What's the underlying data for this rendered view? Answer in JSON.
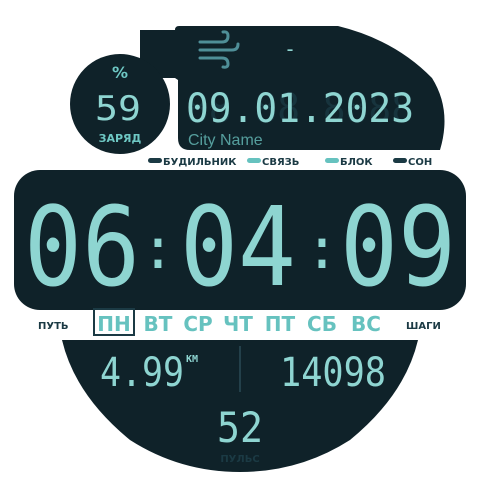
{
  "colors": {
    "panel": "#0f2229",
    "lcd": "#8ed5d1",
    "accent": "#66c2bf",
    "label": "#1b3a44",
    "background": "#ffffff"
  },
  "battery": {
    "symbol": "%",
    "value": "59",
    "label": "ЗАРЯД"
  },
  "weather": {
    "icon": "wind-icon",
    "value": "-"
  },
  "date": {
    "value": "09.01.2023",
    "ghost": "88.88.8888"
  },
  "city": "City Name",
  "status_indicators": [
    {
      "label": "БУДИЛЬНИК"
    },
    {
      "label": "СВЯЗЬ"
    },
    {
      "label": "БЛОК"
    },
    {
      "label": "СОН"
    }
  ],
  "time": {
    "hours": "06",
    "minutes": "04",
    "seconds": "09",
    "separator": ":"
  },
  "week": {
    "left_label": "ПУТЬ",
    "right_label": "ШАГИ",
    "days": [
      "ПН",
      "ВТ",
      "СР",
      "ЧТ",
      "ПТ",
      "СБ",
      "ВС"
    ],
    "selected": "ПН"
  },
  "distance": {
    "value": "4.99",
    "unit": "КМ"
  },
  "steps": {
    "value": "14098"
  },
  "pulse": {
    "value": "52",
    "label": "ПУЛЬС"
  }
}
